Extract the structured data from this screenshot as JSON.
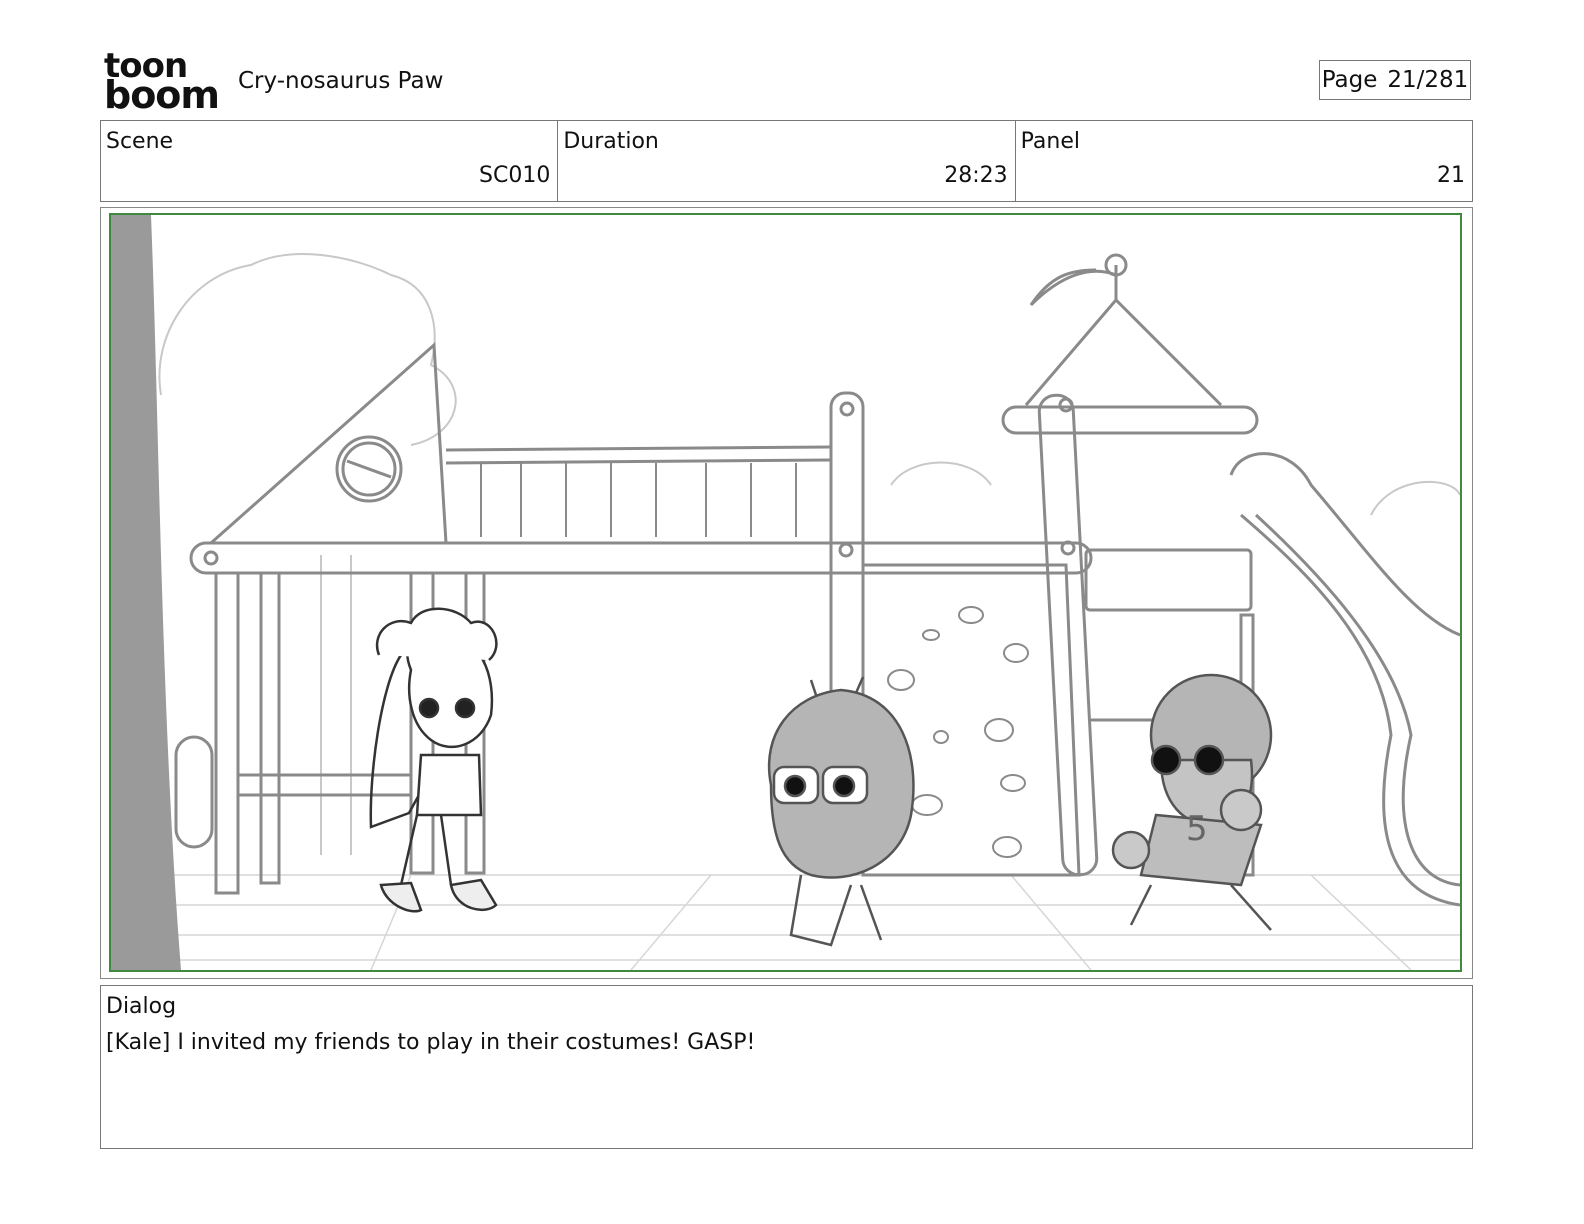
{
  "header": {
    "logo": {
      "text_line1": "toon",
      "text_line2": "boom"
    },
    "project_title": "Cry-nosaurus Paw",
    "page_label": "Page",
    "page_value": "21/281"
  },
  "info": {
    "scene_label": "Scene",
    "scene_value": "SC010",
    "duration_label": "Duration",
    "duration_value": "28:23",
    "panel_label": "Panel",
    "panel_value": "21"
  },
  "dialog": {
    "label": "Dialog",
    "text": "[Kale] I invited my friends to play in their costumes! GASP!"
  },
  "colors": {
    "frame_border": "#3f8a3f",
    "sketch_line": "#8a8a8a",
    "fill_gray": "#b8b8b8"
  }
}
